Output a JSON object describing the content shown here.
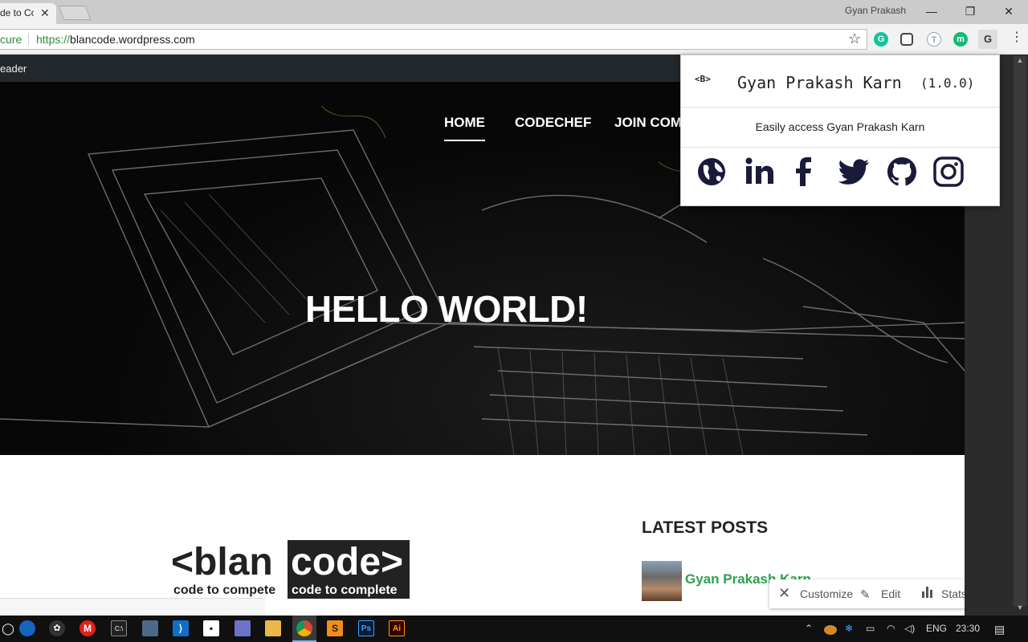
{
  "browser": {
    "tab_title": "de to Co",
    "tab_close": "✕",
    "user_name": "Gyan Prakash",
    "win_minimize": "—",
    "win_restore": "❐",
    "win_close": "✕",
    "secure_label": "cure",
    "url_scheme": "https://",
    "url_host": "blancode.wordpress.com",
    "star": "☆",
    "menu": "⋮",
    "extensions": [
      {
        "name": "grammarly",
        "label": "G",
        "color": "#15c39a"
      },
      {
        "name": "extension-2",
        "label": "",
        "color": "#555555"
      },
      {
        "name": "extension-t",
        "label": "T",
        "color": "#9aa6b2"
      },
      {
        "name": "extension-m",
        "label": "m",
        "color": "#17b978"
      },
      {
        "name": "extension-g",
        "label": "G",
        "color": "#dddddd"
      }
    ]
  },
  "wp_admin": {
    "reader": "eader"
  },
  "site": {
    "nav": {
      "home": "HOME",
      "codechef": "CODECHEF",
      "join": "JOIN COM"
    },
    "hero_title": "HELLO WORLD!",
    "logo_left": "<blan",
    "logo_right": "code>",
    "tagline_left": "code to compete",
    "tagline_right": "code to complete",
    "latest_heading": "LATEST POSTS",
    "post_author": "Gyan Prakash Karn"
  },
  "wp_actions": {
    "customize": "Customize",
    "edit": "Edit",
    "stats": "Stats",
    "more": "•••"
  },
  "popup": {
    "logo": "<B>",
    "title": "Gyan Prakash Karn",
    "version": "(1.0.0)",
    "description": "Easily access Gyan Prakash Karn",
    "social": [
      "globe-icon",
      "linkedin-icon",
      "facebook-icon",
      "twitter-icon",
      "github-icon",
      "instagram-icon"
    ],
    "icon_color": "#1a1a3a"
  },
  "taskbar": {
    "language": "ENG",
    "time": "23:30"
  }
}
